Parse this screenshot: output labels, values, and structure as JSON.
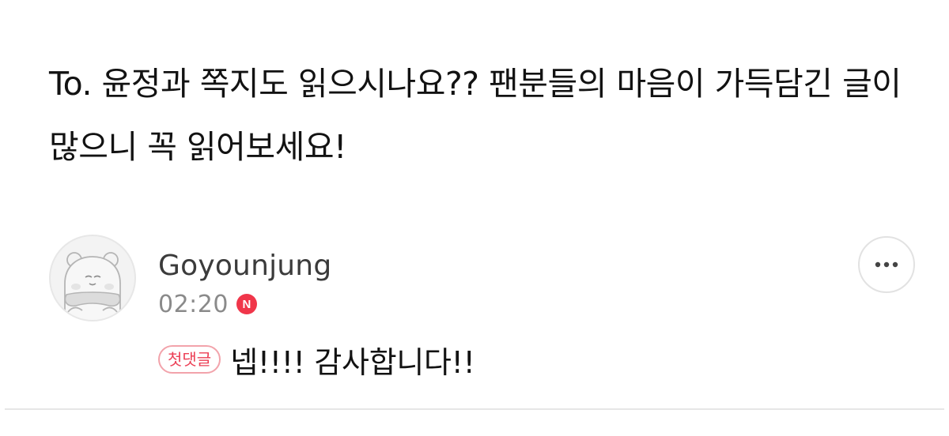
{
  "post": {
    "text": "To. 윤정과 쪽지도 읽으시나요?? 팬분들의 마음이 가득담긴 글이 많으니 꼭 읽어보세요!"
  },
  "comment": {
    "author": "Goyounjung",
    "time": "02:20",
    "new_badge": "N",
    "first_comment_badge": "첫댓글",
    "text": "넵!!!! 감사합니다!!",
    "avatar_icon": "bear-avatar-icon",
    "more_icon": "more-dots-icon"
  },
  "colors": {
    "accent": "#f0364a",
    "badge_border": "#f2a3ab",
    "meta_text": "#8a8a8a"
  }
}
